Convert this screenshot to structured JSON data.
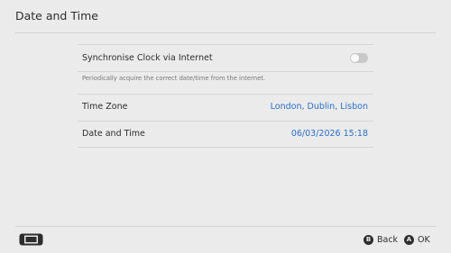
{
  "header": {
    "title": "Date and Time"
  },
  "settings": {
    "sync": {
      "label": "Synchronise Clock via Internet",
      "enabled": false,
      "description": "Periodically acquire the correct date/time from the internet."
    },
    "timezone": {
      "label": "Time Zone",
      "value": "London, Dublin, Lisbon"
    },
    "datetime": {
      "label": "Date and Time",
      "value": "06/03/2026 15:18"
    }
  },
  "footer": {
    "console_icon": "handheld-console-icon",
    "back": {
      "glyph": "B",
      "label": "Back"
    },
    "ok": {
      "glyph": "A",
      "label": "OK"
    }
  },
  "colors": {
    "accent": "#2a6fc4",
    "background": "#ebebeb",
    "toggle_off": "#c8c8c8"
  }
}
